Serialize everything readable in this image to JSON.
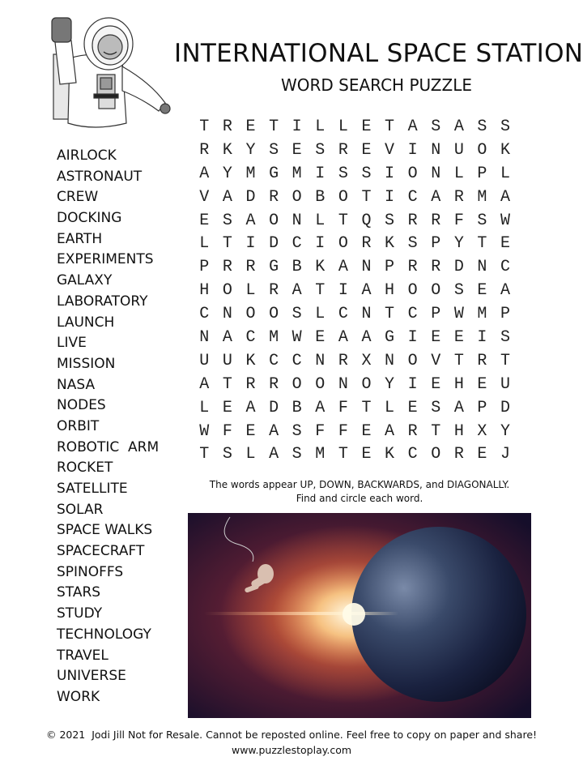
{
  "header": {
    "title": "INTERNATIONAL SPACE STATION",
    "subtitle": "WORD SEARCH PUZZLE"
  },
  "illustration": {
    "icon": "astronaut-waving-icon"
  },
  "word_list": [
    "AIRLOCK",
    "ASTRONAUT",
    "CREW",
    "DOCKING",
    "EARTH",
    "EXPERIMENTS",
    "GALAXY",
    "LABORATORY",
    "LAUNCH",
    "LIVE",
    "MISSION",
    "NASA",
    "NODES",
    "ORBIT",
    "ROBOTIC  ARM",
    "ROCKET",
    "SATELLITE",
    "SOLAR",
    "SPACE WALKS",
    "SPACECRAFT",
    "SPINOFFS",
    "STARS",
    "STUDY",
    "TECHNOLOGY",
    "TRAVEL",
    "UNIVERSE",
    "WORK"
  ],
  "grid": [
    "TRETILLETASASS",
    "RKYSESREVINUOK",
    "AYMGMISSIONLPL",
    "VADROBOTICARMA",
    "ESAONLTQSRRFSW",
    "LTIDCIORKSPYTE",
    "PRRGBKANPRRDNC",
    "HOLRATIAHOOSEA",
    "CNOOSLCNTCPWMP",
    "NACMWEAAGIEEIS",
    "UUKCCNRXNOVTRT",
    "ATRROONOYIEHEU",
    "LEADBAFTLESAPD",
    "WFEASFFEARTHXY",
    "TSLASMTEKCOREJ"
  ],
  "instructions": {
    "line1": "The words appear UP, DOWN, BACKWARDS, and DIAGONALLY.",
    "line2": "Find and circle each word."
  },
  "photo": {
    "subject": "astronaut-floating-near-earth-sunrise"
  },
  "footer": {
    "copyright": "© 2021  Jodi Jill Not for Resale. Cannot be reposted online. Feel free to copy on paper and share!",
    "website": "www.puzzlestoplay.com"
  }
}
